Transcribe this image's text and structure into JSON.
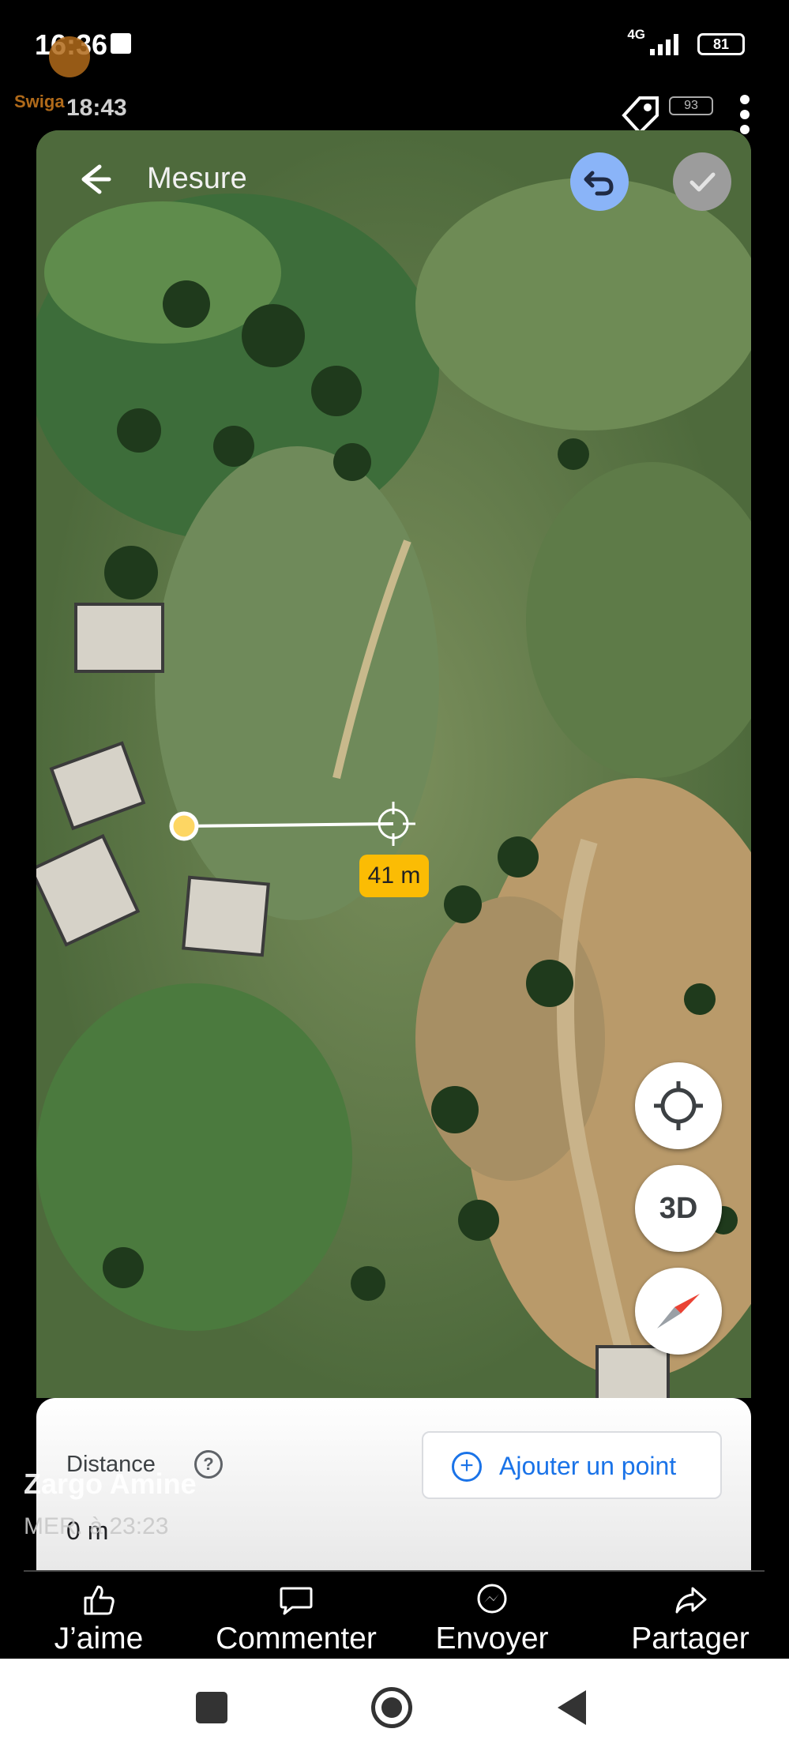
{
  "status_bar": {
    "time": "16:36",
    "network": "4G",
    "battery": "81"
  },
  "watermark": {
    "text": "Swiga"
  },
  "inner_status": {
    "time": "18:43",
    "battery": "93"
  },
  "map_screen": {
    "title": "Mesure",
    "measurement_label": "41 m",
    "fab_3d_label": "3D"
  },
  "bottom_sheet": {
    "distance_label": "Distance",
    "distance_value": "0 m",
    "add_point_label": "Ajouter un point"
  },
  "post": {
    "author": "Zargo Amine",
    "time": "MER. à 23:23"
  },
  "actions": {
    "like": "J’aime",
    "comment": "Commenter",
    "send": "Envoyer",
    "share": "Partager"
  },
  "colors": {
    "accent_blue": "#1a73e8",
    "undo_blue": "#8ab4f8",
    "measure_yellow": "#fbbc04"
  }
}
